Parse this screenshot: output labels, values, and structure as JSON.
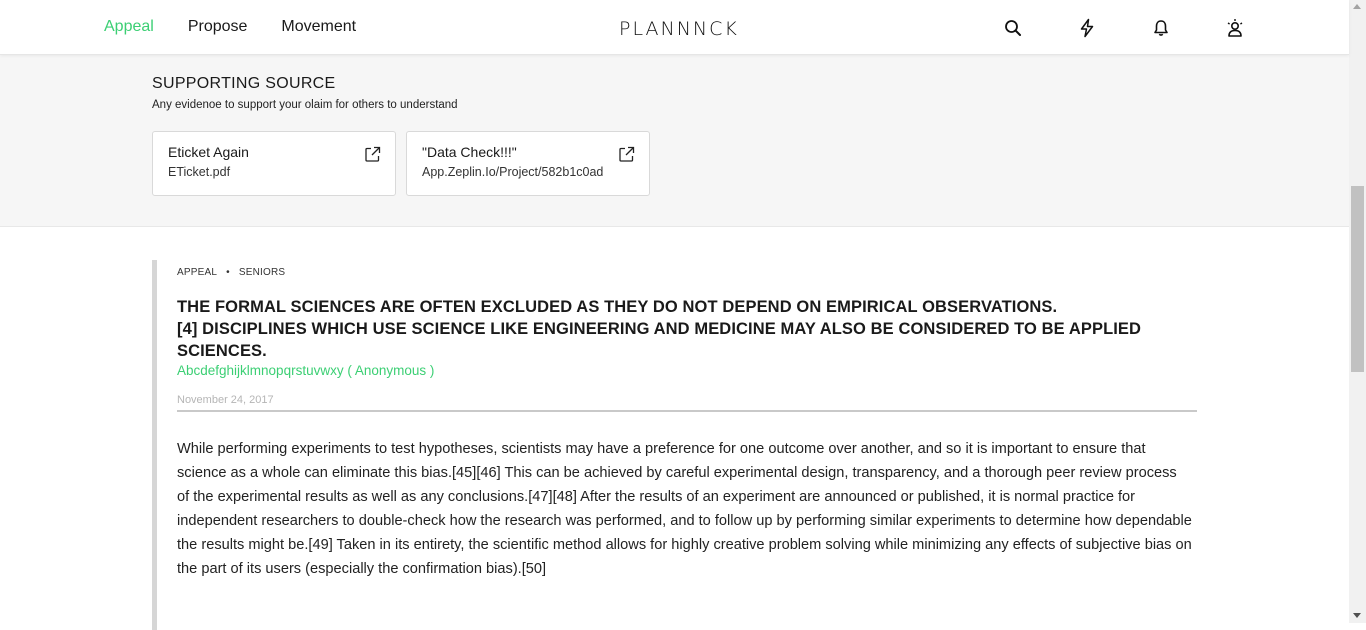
{
  "nav": {
    "items": [
      {
        "label": "Appeal",
        "active": true
      },
      {
        "label": "Propose",
        "active": false
      },
      {
        "label": "Movement",
        "active": false
      }
    ],
    "logo": "PLANNNCK",
    "icons": [
      "search-icon",
      "lightning-icon",
      "bell-icon",
      "user-icon"
    ]
  },
  "support": {
    "heading": "SUPPORTING SOURCE",
    "description": "Any evidenoe to support your olaim for others to understand",
    "sources": [
      {
        "title": "Eticket Again",
        "subtitle": "ETicket.pdf"
      },
      {
        "title": "\"Data Check!!!\"",
        "subtitle": "App.Zeplin.Io/Project/582b1c0ad"
      }
    ]
  },
  "article": {
    "category": "APPEAL",
    "subcategory": "SENIORS",
    "title_line1": "THE FORMAL SCIENCES ARE OFTEN EXCLUDED AS THEY DO NOT DEPEND ON EMPIRICAL OBSERVATIONS.",
    "title_line2": "[4] DISCIPLINES WHICH USE SCIENCE LIKE ENGINEERING AND MEDICINE MAY ALSO BE CONSIDERED TO BE APPLIED SCIENCES.",
    "author": "Abcdefghijklmnopqrstuvwxy ( Anonymous )",
    "date": "November 24, 2017",
    "body": "While performing experiments to test hypotheses, scientists may have a preference for one outcome over another, and so it is important to ensure that science as a whole can eliminate this bias.[45][46] This can be achieved by careful experimental design, transparency, and a thorough peer review process of the experimental results as well as any conclusions.[47][48] After the results of an experiment are announced or published, it is normal practice for independent researchers to double-check how the research was performed, and to follow up by performing similar experiments to determine how dependable the results might be.[49] Taken in its entirety, the scientific method allows for highly creative problem solving while minimizing any effects of subjective bias on the part of its users (especially the confirmation bias).[50]"
  },
  "colors": {
    "accent": "#3ccf74",
    "support_bg": "#f6f6f6",
    "article_border": "#d6d6d6"
  }
}
